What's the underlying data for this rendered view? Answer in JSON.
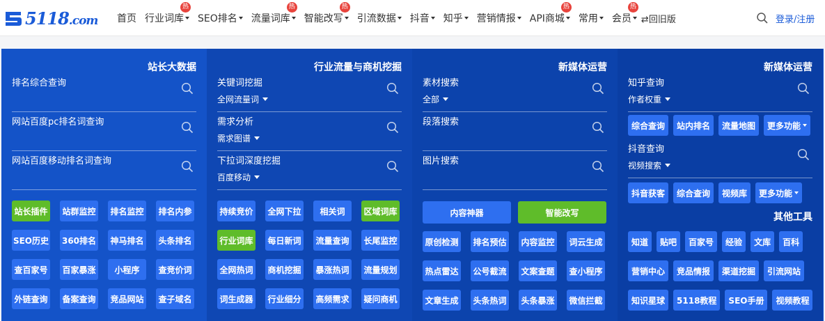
{
  "logo": {
    "text": "5118",
    "suffix": ".com"
  },
  "nav": {
    "items": [
      {
        "label": "首页",
        "caret": false,
        "hot": false
      },
      {
        "label": "行业词库",
        "caret": true,
        "hot": true
      },
      {
        "label": "SEO排名",
        "caret": true,
        "hot": false
      },
      {
        "label": "流量词库",
        "caret": true,
        "hot": true
      },
      {
        "label": "智能改写",
        "caret": true,
        "hot": true
      },
      {
        "label": "引流数据",
        "caret": true,
        "hot": false
      },
      {
        "label": "抖音",
        "caret": true,
        "hot": false
      },
      {
        "label": "知乎",
        "caret": true,
        "hot": false
      },
      {
        "label": "营销情报",
        "caret": true,
        "hot": false
      },
      {
        "label": "API商城",
        "caret": true,
        "hot": true
      },
      {
        "label": "常用",
        "caret": true,
        "hot": false
      },
      {
        "label": "会员",
        "caret": true,
        "hot": true
      }
    ],
    "hot_label": "热",
    "old_version": "⇄回旧版",
    "login": "登录/注册"
  },
  "col1": {
    "title": "站长大数据",
    "fields": [
      {
        "label": "排名综合查询",
        "sub": ""
      },
      {
        "label": "网站百度pc排名词查询",
        "sub": ""
      },
      {
        "label": "网站百度移动排名词查询",
        "sub": ""
      }
    ],
    "buttons": [
      {
        "label": "站长插件",
        "green": true
      },
      {
        "label": "站群监控",
        "green": false
      },
      {
        "label": "排名监控",
        "green": false
      },
      {
        "label": "排名内参",
        "green": false
      },
      {
        "label": "SEO历史",
        "green": false
      },
      {
        "label": "360排名",
        "green": false
      },
      {
        "label": "神马排名",
        "green": false
      },
      {
        "label": "头条排名",
        "green": false
      },
      {
        "label": "查百家号",
        "green": false
      },
      {
        "label": "百家暴涨",
        "green": false
      },
      {
        "label": "小程序",
        "green": false
      },
      {
        "label": "查竞价词",
        "green": false
      },
      {
        "label": "外链查询",
        "green": false
      },
      {
        "label": "备案查询",
        "green": false
      },
      {
        "label": "竞品网站",
        "green": false
      },
      {
        "label": "查子域名",
        "green": false
      }
    ]
  },
  "col2": {
    "title": "行业流量与商机挖掘",
    "fields": [
      {
        "label": "关键词挖掘",
        "sub": "全网流量词"
      },
      {
        "label": "需求分析",
        "sub": "需求图谱"
      },
      {
        "label": "下拉词深度挖掘",
        "sub": "百度移动"
      }
    ],
    "buttons": [
      {
        "label": "持续竞价",
        "green": false
      },
      {
        "label": "全网下拉",
        "green": false
      },
      {
        "label": "相关词",
        "green": false
      },
      {
        "label": "区域词库",
        "green": true
      },
      {
        "label": "行业词库",
        "green": true
      },
      {
        "label": "每日新词",
        "green": false
      },
      {
        "label": "流量查询",
        "green": false
      },
      {
        "label": "长尾监控",
        "green": false
      },
      {
        "label": "全网热词",
        "green": false
      },
      {
        "label": "商机挖掘",
        "green": false
      },
      {
        "label": "暴涨热词",
        "green": false
      },
      {
        "label": "流量规划",
        "green": false
      },
      {
        "label": "词生成器",
        "green": false
      },
      {
        "label": "行业细分",
        "green": false
      },
      {
        "label": "高频需求",
        "green": false
      },
      {
        "label": "疑问商机",
        "green": false
      }
    ]
  },
  "col3": {
    "title": "新媒体运营",
    "fields": [
      {
        "label": "素材搜索",
        "sub": "全部"
      },
      {
        "label": "段落搜索",
        "sub": ""
      },
      {
        "label": "图片搜索",
        "sub": ""
      }
    ],
    "wide_buttons": [
      {
        "label": "内容神器",
        "green": false
      },
      {
        "label": "智能改写",
        "green": true
      }
    ],
    "buttons": [
      {
        "label": "原创检测",
        "green": false
      },
      {
        "label": "排名预估",
        "green": false
      },
      {
        "label": "内容监控",
        "green": false
      },
      {
        "label": "词云生成",
        "green": false
      },
      {
        "label": "热点雷达",
        "green": false
      },
      {
        "label": "公号截流",
        "green": false
      },
      {
        "label": "文案查题",
        "green": false
      },
      {
        "label": "查小程序",
        "green": false
      },
      {
        "label": "文章生成",
        "green": false
      },
      {
        "label": "头条热词",
        "green": false
      },
      {
        "label": "头条暴涨",
        "green": false
      },
      {
        "label": "微信拦截",
        "green": false
      }
    ]
  },
  "col4": {
    "title": "新媒体运营",
    "zhihu": {
      "label": "知乎查询",
      "sub": "作者权重"
    },
    "zhihu_buttons": [
      "综合查询",
      "站内排名",
      "流量地图",
      "更多功能"
    ],
    "douyin": {
      "label": "抖音查询",
      "sub": "视频搜索"
    },
    "douyin_buttons": [
      "抖音获客",
      "综合查询",
      "视频库",
      "更多功能"
    ],
    "other_title": "其他工具",
    "other_row1": [
      "知道",
      "贴吧",
      "百家号",
      "经验",
      "文库",
      "百科"
    ],
    "other_row2": [
      "营销中心",
      "竞品情报",
      "渠道挖掘",
      "引流网站"
    ],
    "other_row3": [
      "知识星球",
      "5118教程",
      "SEO手册",
      "视频教程"
    ]
  }
}
